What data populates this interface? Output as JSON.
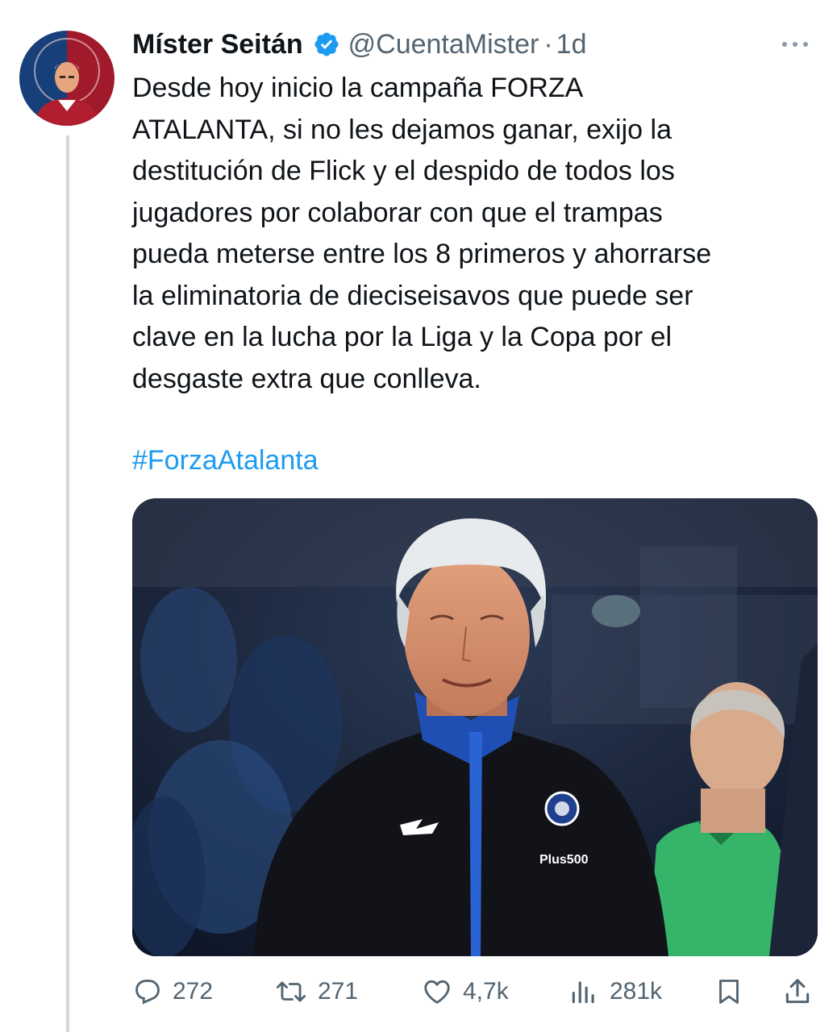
{
  "author": {
    "display_name": "Míster Seitán",
    "handle": "@CuentaMister",
    "separator": "·",
    "time": "1d",
    "verified": true,
    "avatar_icon": "profile-avatar"
  },
  "tweet": {
    "text": "Desde hoy inicio la campaña FORZA\nATALANTA, si no les dejamos ganar, exijo la\ndestitución de Flick y el despido de todos los\njugadores por colaborar con que el trampas\npueda meterse entre los 8 primeros y ahorrarse\nla eliminatoria de dieciseisavos que puede ser\nclave en la lucha por la Liga y la Copa por el\ndesgaste extra que conlleva.",
    "hashtag": "#ForzaAtalanta"
  },
  "media": {
    "jacket_brand": "Plus500"
  },
  "actions": {
    "replies": "272",
    "retweets": "271",
    "likes": "4,7k",
    "views": "281k"
  },
  "colors": {
    "link": "#1d9bf0",
    "secondary_text": "#536471",
    "verified_badge": "#1d9bf0"
  }
}
